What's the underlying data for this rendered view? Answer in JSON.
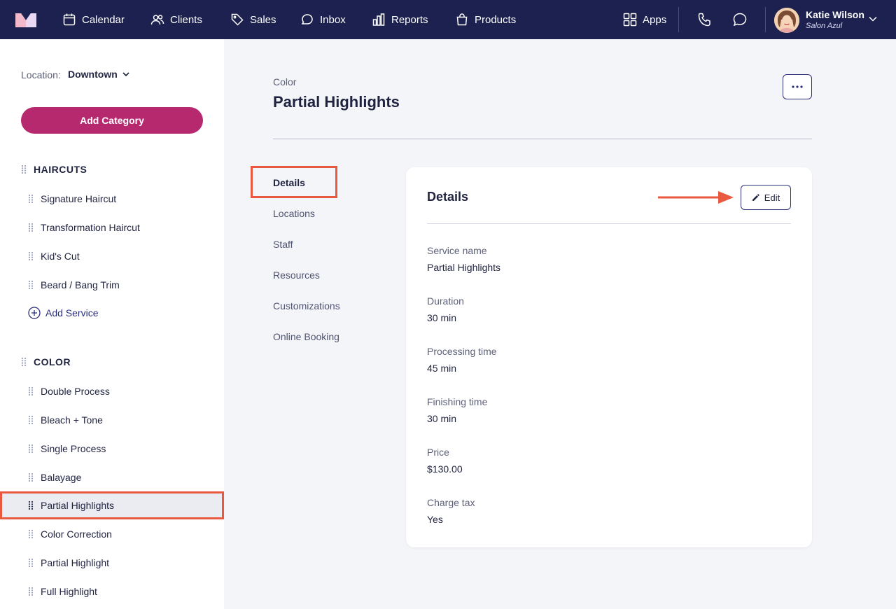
{
  "nav": {
    "items": [
      {
        "label": "Calendar",
        "icon": "calendar-icon"
      },
      {
        "label": "Clients",
        "icon": "users-icon"
      },
      {
        "label": "Sales",
        "icon": "tag-icon"
      },
      {
        "label": "Inbox",
        "icon": "chat-icon"
      },
      {
        "label": "Reports",
        "icon": "bar-chart-icon"
      },
      {
        "label": "Products",
        "icon": "shopping-bag-icon"
      }
    ],
    "apps_label": "Apps",
    "user_name": "Katie Wilson",
    "user_subtitle": "Salon Azul"
  },
  "sidebar": {
    "location_label": "Location:",
    "location_value": "Downtown",
    "add_category_label": "Add Category",
    "categories": [
      {
        "name": "HAIRCUTS",
        "services": [
          "Signature Haircut",
          "Transformation Haircut",
          "Kid's Cut",
          "Beard / Bang Trim"
        ],
        "add_service_label": "Add Service"
      },
      {
        "name": "COLOR",
        "services": [
          "Double Process",
          "Bleach + Tone",
          "Single Process",
          "Balayage",
          "Partial Highlights",
          "Color Correction",
          "Partial Highlight",
          "Full Highlight"
        ]
      }
    ],
    "active_service": "Partial Highlights"
  },
  "main": {
    "breadcrumb": "Color",
    "title": "Partial Highlights",
    "tabs": [
      "Details",
      "Locations",
      "Staff",
      "Resources",
      "Customizations",
      "Online Booking"
    ],
    "active_tab": "Details"
  },
  "details": {
    "title": "Details",
    "edit_label": "Edit",
    "fields": [
      {
        "label": "Service name",
        "value": "Partial Highlights"
      },
      {
        "label": "Duration",
        "value": "30 min"
      },
      {
        "label": "Processing time",
        "value": "45 min"
      },
      {
        "label": "Finishing time",
        "value": "30 min"
      },
      {
        "label": "Price",
        "value": "$130.00"
      },
      {
        "label": "Charge tax",
        "value": "Yes"
      }
    ]
  },
  "colors": {
    "nav_bg": "#1d2150",
    "accent": "#b7296f",
    "highlight": "#e8593f"
  }
}
